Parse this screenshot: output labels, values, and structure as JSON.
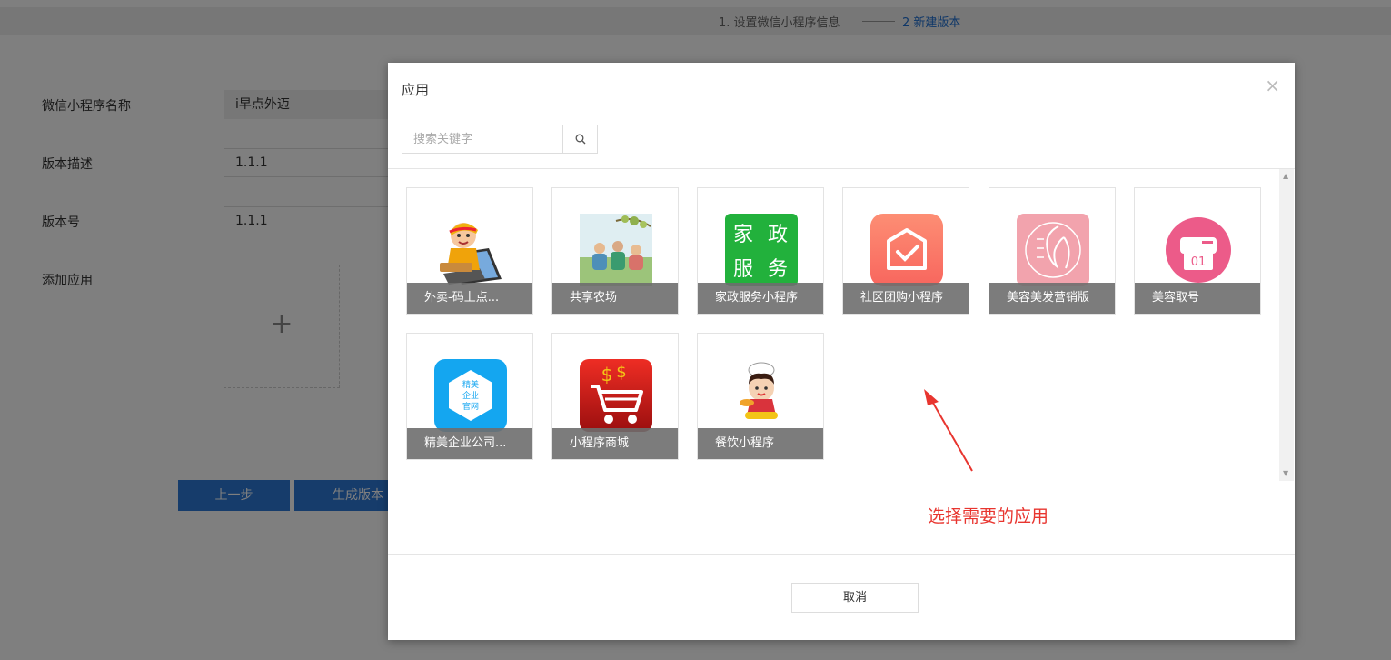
{
  "steps": {
    "step1": "1. 设置微信小程序信息",
    "step2": "2 新建版本"
  },
  "form": {
    "name_label": "微信小程序名称",
    "name_value": "i早点外迈",
    "desc_label": "版本描述",
    "desc_value": "1.1.1",
    "version_label": "版本号",
    "version_value": "1.1.1",
    "add_app_label": "添加应用",
    "add_plus": "+",
    "prev_button": "上一步",
    "generate_button": "生成版本"
  },
  "modal": {
    "title": "应用",
    "close": "×",
    "search_placeholder": "搜索关键字",
    "cancel": "取消",
    "apps": [
      {
        "label": "外卖-码上点...",
        "icon": "delivery-boy-icon"
      },
      {
        "label": "共享农场",
        "icon": "farm-picnic-icon"
      },
      {
        "label": "家政服务小程序",
        "icon": "housekeeping-icon",
        "icon_text": [
          "家",
          "政",
          "服",
          "务"
        ],
        "color": "#22b13c"
      },
      {
        "label": "社区团购小程序",
        "icon": "community-groupbuy-icon",
        "color": "#fb7a6b"
      },
      {
        "label": "美容美发营销版",
        "icon": "beauty-salon-icon",
        "color": "#f2a3ad"
      },
      {
        "label": "美容取号",
        "icon": "queue-ticket-icon",
        "icon_text": "01",
        "color": "#ec5b89"
      },
      {
        "label": "精美企业公司...",
        "icon": "enterprise-site-icon",
        "icon_text": [
          "精美",
          "企业",
          "官网"
        ],
        "color": "#14a6f0"
      },
      {
        "label": "小程序商城",
        "icon": "shopping-cart-icon",
        "color": "#c91a1a"
      },
      {
        "label": "餐饮小程序",
        "icon": "chef-girl-icon"
      }
    ]
  },
  "annotation": {
    "text": "选择需要的应用",
    "color": "#e8352f"
  }
}
